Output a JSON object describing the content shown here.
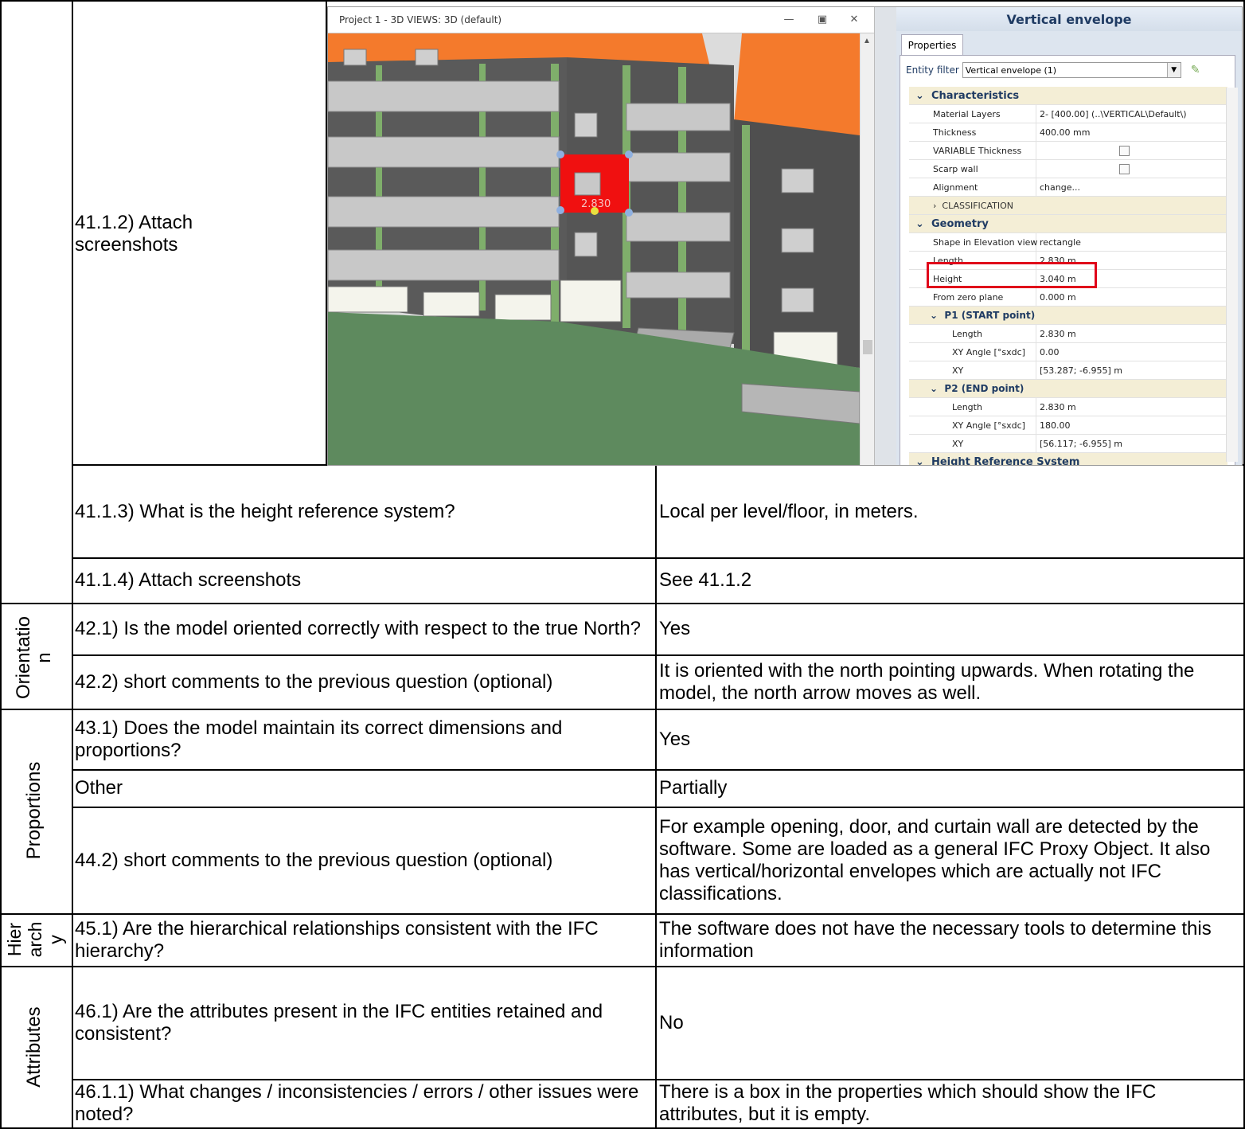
{
  "rows": {
    "r41_1_2": {
      "question": "41.1.2) Attach screenshots"
    },
    "r41_1_3": {
      "question": "41.1.3) What is the height reference system?",
      "answer": "Local per level/floor, in meters."
    },
    "r41_1_4": {
      "question": "41.1.4) Attach screenshots",
      "answer": "See 41.1.2"
    },
    "r42_1": {
      "question": "42.1) Is the model oriented correctly with respect to the true North?",
      "answer": "Yes"
    },
    "r42_2": {
      "question": "42.2) short comments to the previous question (optional)",
      "answer": "It is oriented with the north pointing upwards. When rotating the model, the north arrow moves as well."
    },
    "r43_1": {
      "question": "43.1) Does the model maintain its correct dimensions and proportions?",
      "answer": "Yes"
    },
    "r_other": {
      "question": "Other",
      "answer": "Partially"
    },
    "r44_2": {
      "question": "44.2) short comments to the previous question (optional)",
      "answer": "For example opening, door, and curtain wall are detected by the software. Some are loaded as a general IFC Proxy Object. It also has vertical/horizontal envelopes which are actually not IFC classifications."
    },
    "r45_1": {
      "question": "45.1) Are the hierarchical relationships consistent with the IFC hierarchy?",
      "answer": "The software does not have the necessary tools to determine this information"
    },
    "r46_1": {
      "question": "46.1) Are the attributes present in the IFC entities retained and consistent?",
      "answer": "No"
    },
    "r46_1_1": {
      "question": "46.1.1) What changes / inconsistencies / errors / other issues were noted?",
      "answer": "There is a box in the properties which should show the IFC attributes, but it is empty."
    }
  },
  "sections": {
    "orientation": "Orientatio\nn",
    "proportions": "Proportions",
    "hierarchy": "Hier\narch\ny",
    "attributes": "Attributes"
  },
  "screenshot": {
    "window_title": "Project 1 -  3D VIEWS: 3D (default)",
    "dimension_label": "2.830",
    "panel_title": "Vertical envelope",
    "tab": "Properties",
    "entity_filter_label": "Entity filter",
    "entity_filter_value": "Vertical envelope (1)",
    "characteristics": {
      "title": "Characteristics",
      "material_layers_k": "Material Layers",
      "material_layers_v": "2- [400.00]   (..\\VERTICAL\\Default\\)",
      "thickness_k": "Thickness",
      "thickness_v": "400.00 mm",
      "variable_k": "VARIABLE Thickness",
      "scarp_k": "Scarp wall",
      "alignment_k": "Alignment",
      "alignment_v": "change...",
      "classification": "CLASSIFICATION"
    },
    "geometry": {
      "title": "Geometry",
      "shape_k": "Shape in Elevation view",
      "shape_v": "rectangle",
      "length_k": "Length",
      "length_v": "2.830 m",
      "height_k": "Height",
      "height_v": "3.040 m",
      "zero_k": "From zero plane",
      "zero_v": "0.000 m"
    },
    "p1": {
      "title": "P1 (START point)",
      "length_k": "Length",
      "length_v": "2.830 m",
      "angle_k": "XY Angle  [°sxdc]",
      "angle_v": "0.00",
      "xy_k": "XY",
      "xy_v": "[53.287; -6.955] m"
    },
    "p2": {
      "title": "P2 (END point)",
      "length_k": "Length",
      "length_v": "2.830 m",
      "angle_k": "XY Angle  [°sxdc]",
      "angle_v": "180.00",
      "xy_k": "XY",
      "xy_v": "[56.117; -6.955] m"
    },
    "height_ref": "Height Reference System"
  }
}
